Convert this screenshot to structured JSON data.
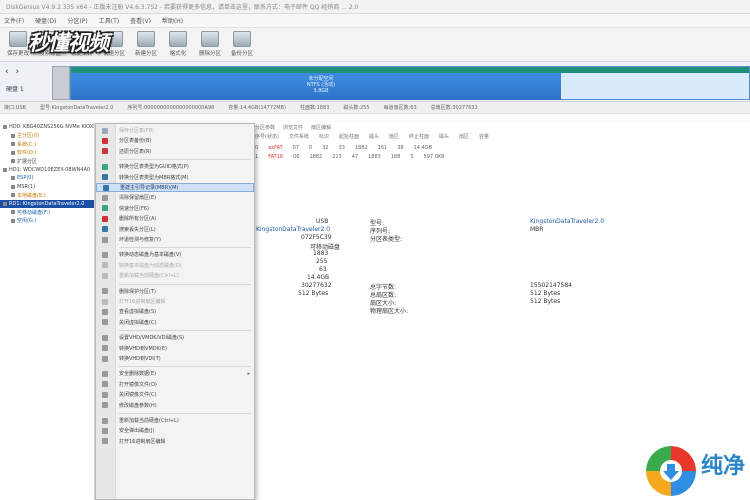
{
  "window": {
    "title": "DiskGenius V4.9.2.335 x64 - 正版未注册 V4.6.3.752 - 若要获得更多信息，请单击这里，联系方式：电子邮件 QQ 经销商 ... 2.0"
  },
  "menubar": {
    "items": [
      "文件(F)",
      "硬盘(D)",
      "分区(P)",
      "工具(T)",
      "查看(V)",
      "帮助(H)"
    ]
  },
  "toolbar": {
    "buttons": [
      {
        "label": "保存更改",
        "icon": "save-icon"
      },
      {
        "label": "搜索分区",
        "icon": "search-partition-icon"
      },
      {
        "label": "恢复文件",
        "icon": "recover-file-icon"
      },
      {
        "label": "快速分区",
        "icon": "quick-partition-icon"
      },
      {
        "label": "新建分区",
        "icon": "new-partition-icon"
      },
      {
        "label": "格式化",
        "icon": "format-icon"
      },
      {
        "label": "删除分区",
        "icon": "delete-partition-icon"
      },
      {
        "label": "备份分区",
        "icon": "backup-partition-icon"
      }
    ],
    "watermark": "秒懂视频"
  },
  "disk_panel": {
    "nav_symbols": "‹ ›",
    "disk_label": "硬盘 1",
    "partition_label": "未分配空间\nNTFS (活动)\n3.8GB"
  },
  "disk_info": {
    "text": [
      "接口:USB",
      "型号:KingstonDataTraveler2.0",
      "序列号:0000000000000000000A98",
      "容量:14.4GB(14772MB)",
      "柱面数:1883",
      "磁头数:255",
      "每道扇区数:63",
      "总扇区数:30277632"
    ]
  },
  "tree": {
    "items": [
      {
        "label": "HD0: KBG40ZNS256G NVMe KIOXIA",
        "style": "normal",
        "indent": 0
      },
      {
        "label": "主分区(0)",
        "style": "c",
        "indent": 8
      },
      {
        "label": "系统(C:)",
        "style": "c",
        "indent": 8
      },
      {
        "label": "软件(D:)",
        "style": "c",
        "indent": 8
      },
      {
        "label": "扩展分区",
        "style": "normal",
        "indent": 8
      },
      {
        "label": "HD1: WDCWD10EZEX-08WN4A0",
        "style": "normal",
        "indent": 0
      },
      {
        "label": "ESP(0)",
        "style": "b",
        "indent": 8
      },
      {
        "label": "MSR(1)",
        "style": "normal",
        "indent": 8
      },
      {
        "label": "本地磁盘(E:)",
        "style": "c",
        "indent": 8
      },
      {
        "label": "RD1: KingstonDataTraveler2.0",
        "style": "sel",
        "indent": 0
      },
      {
        "label": "可移动磁盘(F:)",
        "style": "b",
        "indent": 8
      },
      {
        "label": "空闲(G:)",
        "style": "b",
        "indent": 8
      }
    ]
  },
  "context_menu": {
    "items": [
      {
        "label": "保存分区表(F8)",
        "state": "dis",
        "icon_color": "#9ab"
      },
      {
        "label": "分区表备份(B)",
        "state": "normal",
        "icon_color": "#c33"
      },
      {
        "label": "还原分区表(R)",
        "state": "normal",
        "icon_color": "#c33"
      },
      {
        "sep": true
      },
      {
        "label": "转换分区表类型为GUID格式(P)",
        "state": "normal",
        "icon_color": "#3a7"
      },
      {
        "label": "转换分区表类型为MBR格式(M)",
        "state": "normal",
        "icon_color": "#37a"
      },
      {
        "label": "重建主引导记录(MBR)(M)",
        "state": "hl",
        "icon_color": "#37a"
      },
      {
        "label": "清除保留扇区(E)",
        "state": "normal",
        "icon_color": "#999"
      },
      {
        "label": "快速分区(F6)",
        "state": "normal",
        "icon_color": "#3a7"
      },
      {
        "label": "删除所有分区(A)",
        "state": "normal",
        "icon_color": "#c33"
      },
      {
        "label": "搜索丢失分区(L)",
        "state": "normal",
        "icon_color": "#37a"
      },
      {
        "label": "坏道检测与修复(Y)",
        "state": "normal",
        "icon_color": "#999"
      },
      {
        "sep": true
      },
      {
        "label": "转换动态磁盘为基本磁盘(V)",
        "state": "normal",
        "icon_color": "#999"
      },
      {
        "label": "转换基本磁盘为动态磁盘(D)",
        "state": "dis",
        "icon_color": "#bbb"
      },
      {
        "label": "重新加载当前硬盘(Ctrl+L)",
        "state": "dis",
        "icon_color": "#bbb"
      },
      {
        "sep": true
      },
      {
        "label": "删除保护分区(T)",
        "state": "normal",
        "icon_color": "#999"
      },
      {
        "label": "打开16进制扇区编辑",
        "state": "dis",
        "icon_color": "#bbb"
      },
      {
        "label": "查看虚拟磁盘(S)",
        "state": "normal",
        "icon_color": "#999"
      },
      {
        "label": "关闭虚拟磁盘(C)",
        "state": "normal",
        "icon_color": "#999"
      },
      {
        "sep": true
      },
      {
        "label": "设置VHD/VMDK/VDI磁盘(S)",
        "state": "normal",
        "icon_color": "#999"
      },
      {
        "label": "转换VHD到VMDK(E)",
        "state": "normal",
        "icon_color": "#999"
      },
      {
        "label": "转换VHD到VDI(T)",
        "state": "normal",
        "icon_color": "#999"
      },
      {
        "sep": true
      },
      {
        "label": "安全删除数据(E)",
        "state": "normal",
        "icon_color": "#999",
        "submenu": true
      },
      {
        "label": "打开镜像文件(O)",
        "state": "normal",
        "icon_color": "#999"
      },
      {
        "label": "关闭镜像文件(C)",
        "state": "normal",
        "icon_color": "#999"
      },
      {
        "label": "修改磁盘参数(H)",
        "state": "normal",
        "icon_color": "#999"
      },
      {
        "sep": true
      },
      {
        "label": "重新加载当前硬盘(Ctrl+L)",
        "state": "normal",
        "icon_color": "#999"
      },
      {
        "label": "安全弹出磁盘(J)",
        "state": "normal",
        "icon_color": "#999"
      },
      {
        "label": "打开16进制扇区编辑",
        "state": "normal",
        "icon_color": "#999"
      }
    ]
  },
  "partition_table": {
    "tabs": [
      "分区参数",
      "浏览文件",
      "扇区编辑"
    ],
    "headers": [
      "序号(状态)",
      "文件系统",
      "标识",
      "起始柱面",
      "磁头",
      "扇区",
      "终止柱面",
      "磁头",
      "扇区",
      "容量"
    ],
    "rows": [
      [
        "0",
        "exFAT",
        "07",
        "0",
        "32",
        "33",
        "1882",
        "161",
        "38",
        "14.4GB"
      ],
      [
        "1",
        "FAT16",
        "06",
        "1882",
        "223",
        "47",
        "1883",
        "188",
        "5",
        "597.0KB"
      ]
    ]
  },
  "details": {
    "left_values": [
      "USB",
      "KingstonDataTraveler2.0",
      "072F5C39",
      "可移动磁盘",
      "1883",
      "255",
      "63",
      "14.4GB",
      "30277632",
      "512 Bytes"
    ],
    "mid_labels": [
      "型号:",
      "序列号:",
      "分区表类型:",
      "总字节数:",
      "总扇区数:",
      "扇区大小:",
      "物理扇区大小:"
    ],
    "mid_values": [
      "KingstonDataTraveler2.0",
      "MBR",
      "15502147584",
      "512 Bytes",
      "512 Bytes"
    ]
  },
  "logo": {
    "text": "纯净"
  }
}
